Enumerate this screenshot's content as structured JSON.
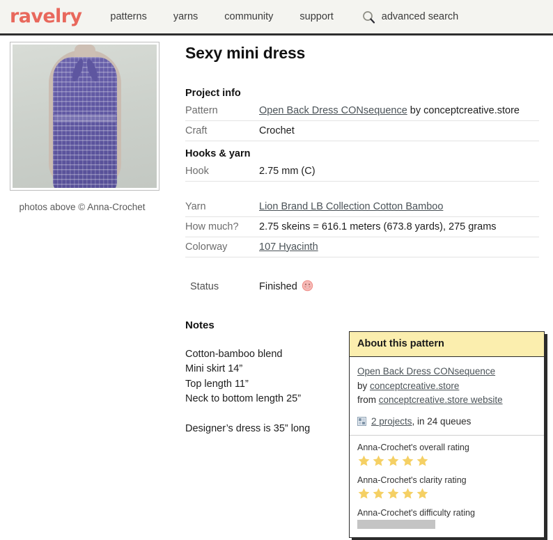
{
  "header": {
    "logo_text": "ravelry",
    "logo_color": "#e8685c",
    "nav": [
      {
        "label": "patterns"
      },
      {
        "label": "yarns"
      },
      {
        "label": "community"
      },
      {
        "label": "support"
      }
    ],
    "search": {
      "icon": "search-icon",
      "label": "advanced search"
    }
  },
  "photo": {
    "alt": "purple crochet halter mini dress on mannequin",
    "credit": "photos above © Anna-Crochet"
  },
  "project": {
    "title": "Sexy mini dress",
    "sections": {
      "project_info": "Project info",
      "hooks_yarn": "Hooks & yarn"
    },
    "rows": [
      {
        "label": "Pattern",
        "link": "Open Back Dress CONsequence",
        "suffix": " by conceptcreative.store"
      },
      {
        "label": "Craft",
        "value": "Crochet"
      },
      {
        "label": "Hook",
        "value": "2.75 mm (C)"
      },
      {
        "label": "Yarn",
        "link": "Lion Brand LB Collection Cotton Bamboo"
      },
      {
        "label": "How much?",
        "value": "2.75 skeins = 616.1 meters (673.8 yards), 275 grams"
      },
      {
        "label": "Colorway",
        "link": "107 Hyacinth"
      }
    ],
    "status": {
      "label": "Status",
      "value": "Finished",
      "emoji": "finished-smiley-icon"
    },
    "notes": {
      "heading": "Notes",
      "body": "Cotton-bamboo blend\nMini skirt 14”\nTop length 11”\nNeck to bottom length 25”\n\nDesigner’s dress is 35” long"
    }
  },
  "about_pattern": {
    "header": "About this pattern",
    "pattern_link": "Open Back Dress CONsequence",
    "by_prefix": "by ",
    "designer_link": "conceptcreative.store",
    "from_prefix": "from ",
    "source_link": "conceptcreative.store website",
    "projects": {
      "icon": "projects-grid-icon",
      "link": "2 projects",
      "suffix": ", in 24 queues"
    },
    "ratings": [
      {
        "label": "Anna-Crochet's overall rating",
        "type": "stars",
        "value": 5,
        "max": 5
      },
      {
        "label": "Anna-Crochet's clarity rating",
        "type": "stars",
        "value": 5,
        "max": 5
      },
      {
        "label": "Anna-Crochet's difficulty rating",
        "type": "bar",
        "value": null
      }
    ],
    "star_color": "#f5d064",
    "header_color": "#fbeeae"
  }
}
